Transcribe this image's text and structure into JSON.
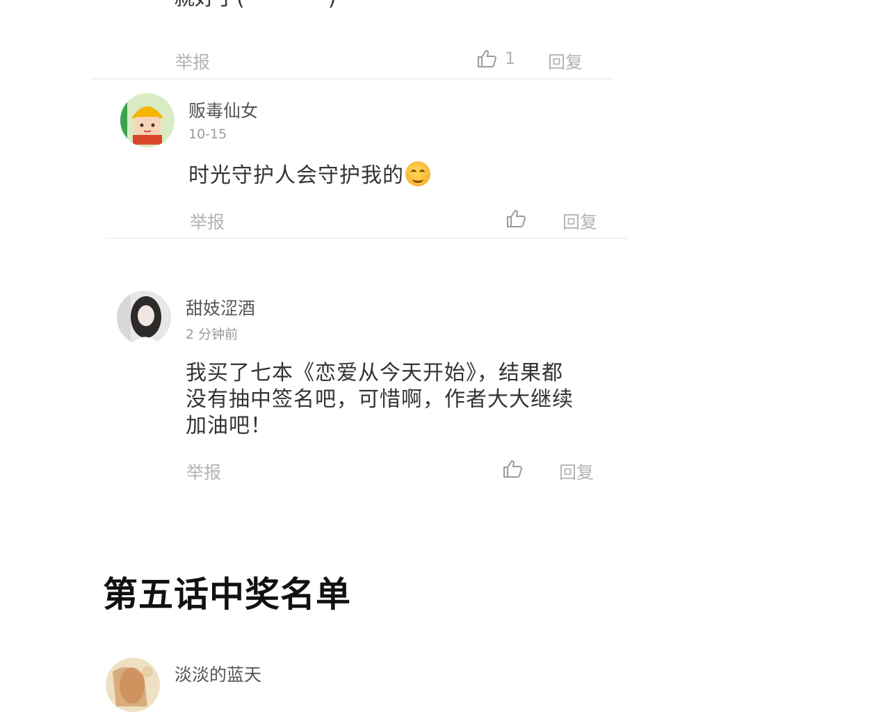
{
  "comments": [
    {
      "content_tail": "就好了(*￣︶￣*)",
      "report": "举报",
      "likes": "1",
      "reply": "回复"
    },
    {
      "username": "贩毒仙女",
      "time": "10-15",
      "content": "时光守护人会守护我的",
      "report": "举报",
      "reply": "回复",
      "emoji": "smiling-face-icon"
    },
    {
      "username": "甜妓涩酒",
      "time": "2 分钟前",
      "content_lines": [
        "我买了七本《恋爱从今天开始》，结果都",
        "没有抽中签名吧，可惜啊，作者大大继续",
        "加油吧！"
      ],
      "report": "举报",
      "reply": "回复"
    }
  ],
  "section": {
    "title": "第五话中奖名单"
  },
  "winner": {
    "username": "淡淡的蓝天"
  },
  "icons": {
    "like": "thumbs-up-icon"
  },
  "colors": {
    "muted": "#b3b3b3",
    "text": "#333333",
    "divider": "#e6e6e6"
  }
}
